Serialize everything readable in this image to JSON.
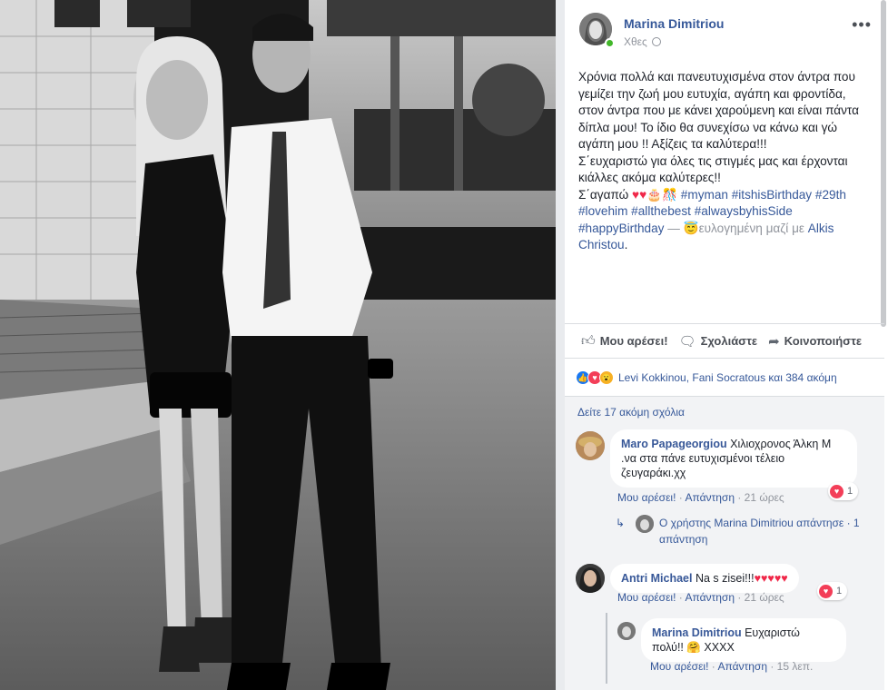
{
  "post": {
    "author": "Marina Dimitriou",
    "time": "Χθες",
    "more_label": "•••",
    "lines": [
      "Χρόνια πολλά και πανευτυχισμένα στον άντρα που",
      "γεμίζει την ζωή μου ευτυχία, αγάπη και φροντίδα,",
      "στον άντρα που με κάνει χαρούμενη και είναι πάντα",
      "δίπλα μου! Το ίδιο θα συνεχίσω να κάνω και γώ",
      "αγάπη μου !! Αξίζεις τα καλύτερα!!!",
      "Σ΄ευχαριστώ για όλες τις στιγμές μας και έρχονται",
      "κιάλλες ακόμα καλύτερες!!"
    ],
    "line8_prefix": "Σ΄αγαπώ ",
    "line8_emojis": "♥♥🎂🎊",
    "line8_tags": " #myman #itshisBirthday #29th",
    "line9": "#lovehim #allthebest #alwaysbyhisSide",
    "line10_tag": "#happyBirthday",
    "line10_dash": " — ",
    "line10_emoji": "😇",
    "line10_rest": "ευλογημένη μαζί με ",
    "line10_name": "Alkis",
    "line11_name": "Christou",
    "line11_end": "."
  },
  "actions": {
    "like": "Μου αρέσει!",
    "comment": "Σχολιάστε",
    "share": "Κοινοποιήστε"
  },
  "reactions": {
    "icons": [
      "👍",
      "♥",
      "😮"
    ],
    "text": "Levi Kokkinou, Fani Socratous και 384 ακόμη"
  },
  "comments_section": {
    "more_comments": "Δείτε 17 ακόμη σχόλια",
    "comment1": {
      "name": "Maro Papageorgiou",
      "text_l1": " Χιλιοχρονος Άλκη Μ",
      "text_l2": ".να στα πάνε ευτυχισμένοι τέλειο",
      "text_l3": "ζευγαράκι.χχ",
      "like": "Μου αρέσει!",
      "reply": "Απάντηση",
      "time": "21 ώρες",
      "likes": "1",
      "reply_summary_l1": "Ο χρήστης Marina Dimitriou απάντησε · 1",
      "reply_summary_l2": "απάντηση"
    },
    "comment2": {
      "name": "Antri Michael",
      "text": " Na s zisei!!!",
      "emojis": "♥♥♥♥♥",
      "like": "Μου αρέσει!",
      "reply": "Απάντηση",
      "time": "21 ώρες",
      "likes": "1"
    },
    "reply1": {
      "name": "Marina Dimitriou",
      "text_l1": " Ευχαριστώ",
      "text_l2": "πολύ!! ",
      "emoji": "🤗",
      "text_l2_end": " ΧΧΧΧ",
      "like": "Μου αρέσει!",
      "reply": "Απάντηση",
      "time": "15 λεπ."
    }
  },
  "colors": {
    "link": "#365899",
    "online": "#42b72a",
    "love": "#f33e58",
    "like": "#1877f2"
  }
}
